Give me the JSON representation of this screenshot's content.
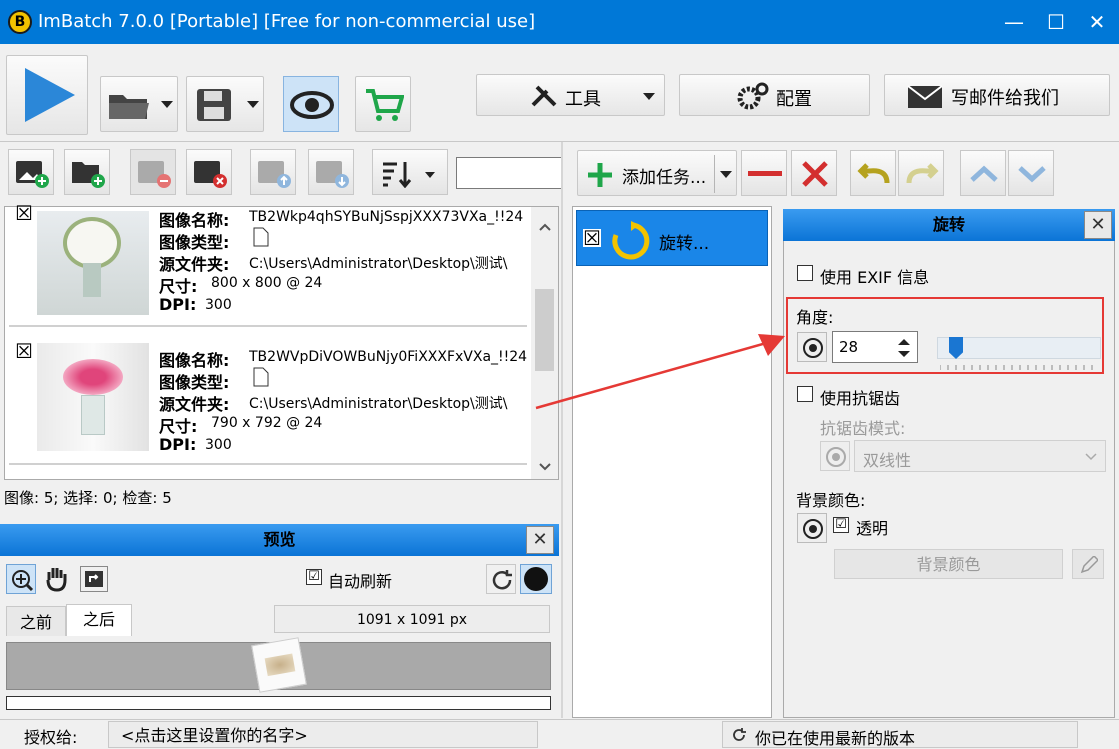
{
  "window": {
    "title": "ImBatch 7.0.0 [Portable] [Free for non-commercial use]",
    "logo_letter": "B"
  },
  "window_controls": {
    "minimize": "—",
    "maximize": "☐",
    "close": "✕"
  },
  "toolbar": {
    "tools_label": "工具",
    "config_label": "配置",
    "email_label": "写邮件给我们"
  },
  "image_toolbar": {
    "search_value": ""
  },
  "images": [
    {
      "name_label": "图像名称:",
      "name": "TB2Wkp4qhSYBuNjSspjXXX73VXa_!!24",
      "type_label": "图像类型:",
      "folder_label": "源文件夹:",
      "folder": "C:\\Users\\Administrator\\Desktop\\测试\\",
      "size_label": "尺寸:",
      "size": "800 x 800 @ 24",
      "dpi_label": "DPI:",
      "dpi": "300",
      "checked": "☒"
    },
    {
      "name_label": "图像名称:",
      "name": "TB2WVpDiVOWBuNjy0FiXXXFxVXa_!!24",
      "type_label": "图像类型:",
      "folder_label": "源文件夹:",
      "folder": "C:\\Users\\Administrator\\Desktop\\测试\\",
      "size_label": "尺寸:",
      "size": "790 x 792 @ 24",
      "dpi_label": "DPI:",
      "dpi": "300",
      "checked": "☒"
    }
  ],
  "status": {
    "counts": "图像: 5; 选择: 0; 检查: 5"
  },
  "preview": {
    "title": "预览",
    "close": "✕",
    "auto_refresh_label": "自动刷新",
    "auto_refresh_checked": "☑",
    "tabs": [
      "之前",
      "之后"
    ],
    "dimensions": "1091 x 1091 px"
  },
  "tasks": {
    "add_task_label": "添加任务...",
    "items": [
      {
        "label": "旋转...",
        "checked": "☒"
      }
    ]
  },
  "rotate_panel": {
    "title": "旋转",
    "close": "✕",
    "use_exif_label": "使用 EXIF 信息",
    "angle_label": "角度:",
    "angle_value": "28",
    "angle_slider_fraction": 0.077,
    "antialias_label": "使用抗锯齿",
    "antialias_mode_label": "抗锯齿模式:",
    "antialias_mode_value": "双线性",
    "bg_color_label": "背景颜色:",
    "transparent_label": "透明",
    "transparent_checked": "☑",
    "bg_color_button": "背景颜色"
  },
  "footer": {
    "license_label": "授权给:",
    "license_value": "<点击这里设置你的名字>",
    "version_status": "你已在使用最新的版本"
  },
  "colors": {
    "titlebar": "#0078d7",
    "accent_blue": "#0e7fe3",
    "highlight_red": "#e53935"
  }
}
